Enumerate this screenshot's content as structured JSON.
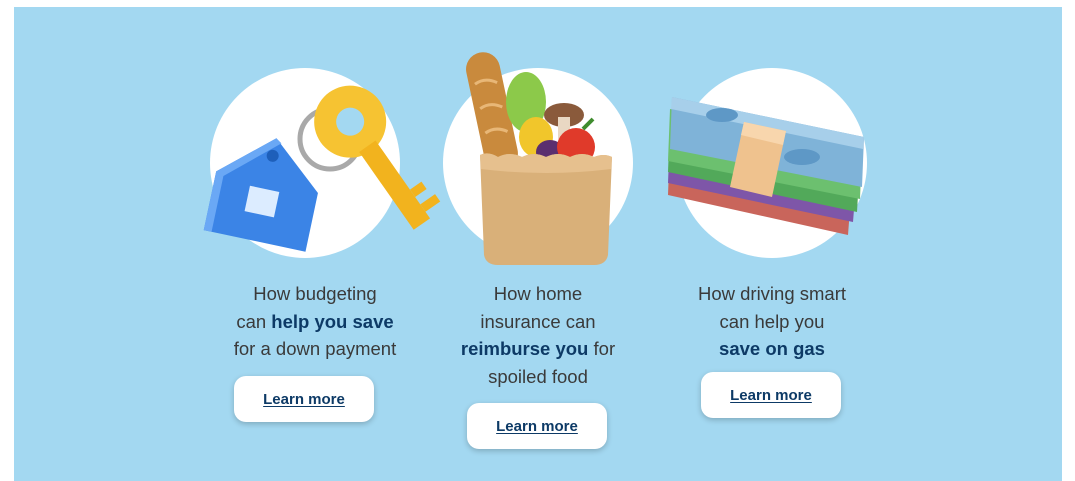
{
  "cards": [
    {
      "caption": [
        {
          "text": "How budgeting",
          "highlight": false
        },
        {
          "text": "\n",
          "highlight": false
        },
        {
          "text": "can ",
          "highlight": false
        },
        {
          "text": "help you save",
          "highlight": true
        },
        {
          "text": "\n",
          "highlight": false
        },
        {
          "text": "for a down payment",
          "highlight": false
        }
      ],
      "button_label": "Learn more",
      "illustration_icon": "house-keys-icon"
    },
    {
      "caption": [
        {
          "text": "How home",
          "highlight": false
        },
        {
          "text": "\n",
          "highlight": false
        },
        {
          "text": "insurance can",
          "highlight": false
        },
        {
          "text": "\n",
          "highlight": false
        },
        {
          "text": "reimburse you",
          "highlight": true
        },
        {
          "text": " for",
          "highlight": false
        },
        {
          "text": "\n",
          "highlight": false
        },
        {
          "text": "spoiled food",
          "highlight": false
        }
      ],
      "button_label": "Learn more",
      "illustration_icon": "grocery-bag-icon"
    },
    {
      "caption": [
        {
          "text": "How driving smart",
          "highlight": false
        },
        {
          "text": "\n",
          "highlight": false
        },
        {
          "text": "can help you",
          "highlight": false
        },
        {
          "text": "\n",
          "highlight": false
        },
        {
          "text": "save on gas",
          "highlight": true
        }
      ],
      "button_label": "Learn more",
      "illustration_icon": "money-stack-icon"
    }
  ],
  "colors": {
    "background": "#a3d8f1",
    "highlight_text": "#0d3a66",
    "body_text": "#3a3a3a",
    "button_bg": "#ffffff"
  }
}
